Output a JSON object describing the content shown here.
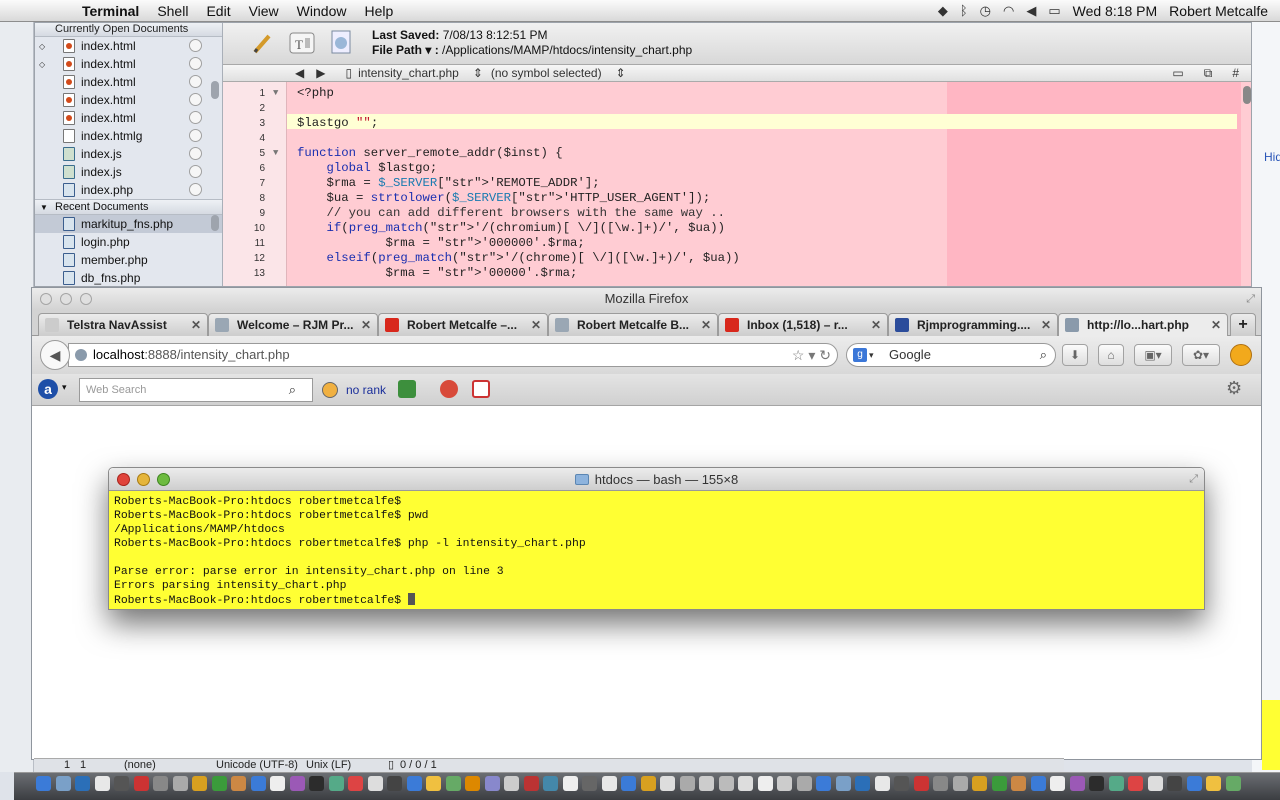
{
  "menubar": {
    "app": "Terminal",
    "items": [
      "Shell",
      "Edit",
      "View",
      "Window",
      "Help"
    ],
    "clock": "Wed 8:18 PM",
    "user": "Robert Metcalfe"
  },
  "editor": {
    "sidebar": {
      "open_header": "Currently Open Documents",
      "open_docs": [
        {
          "name": "index.html",
          "type": "html",
          "dirty": true
        },
        {
          "name": "index.html",
          "type": "html",
          "dirty": true
        },
        {
          "name": "index.html",
          "type": "html",
          "dirty": false
        },
        {
          "name": "index.html",
          "type": "html",
          "dirty": false
        },
        {
          "name": "index.html",
          "type": "html",
          "dirty": false
        },
        {
          "name": "index.htmlg",
          "type": "plain",
          "dirty": false
        },
        {
          "name": "index.js",
          "type": "js",
          "dirty": false
        },
        {
          "name": "index.js",
          "type": "js",
          "dirty": false
        },
        {
          "name": "index.php",
          "type": "php",
          "dirty": false
        }
      ],
      "recent_header": "Recent Documents",
      "recent_docs": [
        "markitup_fns.php",
        "login.php",
        "member.php",
        "db_fns.php"
      ]
    },
    "last_saved_label": "Last Saved:",
    "last_saved": "7/08/13 8:12:51 PM",
    "file_path_label": "File Path ▾ :",
    "file_path": "/Applications/MAMP/htdocs/intensity_chart.php",
    "nav_file": "intensity_chart.php",
    "nav_symbol": "(no symbol selected)",
    "code_lines": [
      {
        "n": "1",
        "text": "<?php"
      },
      {
        "n": "2",
        "text": ""
      },
      {
        "n": "3",
        "text": "$lastgo \"\";"
      },
      {
        "n": "4",
        "text": ""
      },
      {
        "n": "5",
        "text": "function server_remote_addr($inst) {"
      },
      {
        "n": "6",
        "text": "    global $lastgo;"
      },
      {
        "n": "7",
        "text": "    $rma = $_SERVER['REMOTE_ADDR'];"
      },
      {
        "n": "8",
        "text": "    $ua = strtolower($_SERVER['HTTP_USER_AGENT']);"
      },
      {
        "n": "9",
        "text": "    // you can add different browsers with the same way .."
      },
      {
        "n": "10",
        "text": "    if(preg_match('/(chromium)[ \\/]([\\w.]+)/', $ua))"
      },
      {
        "n": "11",
        "text": "            $rma = '000000'.$rma;"
      },
      {
        "n": "12",
        "text": "    elseif(preg_match('/(chrome)[ \\/]([\\w.]+)/', $ua))"
      },
      {
        "n": "13",
        "text": "            $rma = '00000'.$rma;"
      }
    ],
    "status": {
      "line": "1",
      "col": "1",
      "lang": "(none)",
      "encoding": "Unicode (UTF-8)",
      "linebreaks": "Unix (LF)",
      "counts": "0 / 0 / 1"
    }
  },
  "firefox": {
    "title": "Mozilla Firefox",
    "tabs": [
      {
        "label": "Telstra NavAssist",
        "color": "#cccccc"
      },
      {
        "label": "Welcome – RJM Pr...",
        "color": "#9aa7b4"
      },
      {
        "label": "Robert Metcalfe –...",
        "color": "#d8281c"
      },
      {
        "label": "Robert Metcalfe B...",
        "color": "#9aa7b4"
      },
      {
        "label": "Inbox (1,518) – r...",
        "color": "#d8281c"
      },
      {
        "label": "Rjmprogramming....",
        "color": "#2b4c9b"
      },
      {
        "label": "http://lo...hart.php",
        "color": "#8a9aab"
      }
    ],
    "url_domain": "localhost",
    "url_rest": ":8888/intensity_chart.php",
    "search_engine": "Google",
    "toolbar": {
      "web_search_placeholder": "Web Search",
      "rank": "no rank"
    }
  },
  "terminal": {
    "title": "htdocs — bash — 155×8",
    "lines": [
      "Roberts-MacBook-Pro:htdocs robertmetcalfe$",
      "Roberts-MacBook-Pro:htdocs robertmetcalfe$ pwd",
      "/Applications/MAMP/htdocs",
      "Roberts-MacBook-Pro:htdocs robertmetcalfe$ php -l intensity_chart.php",
      "",
      "Parse error: parse error in intensity_chart.php on line 3",
      "Errors parsing intensity_chart.php",
      "Roberts-MacBook-Pro:htdocs robertmetcalfe$ "
    ],
    "background": "#ffff33"
  },
  "background_right": {
    "link": "Hid"
  }
}
